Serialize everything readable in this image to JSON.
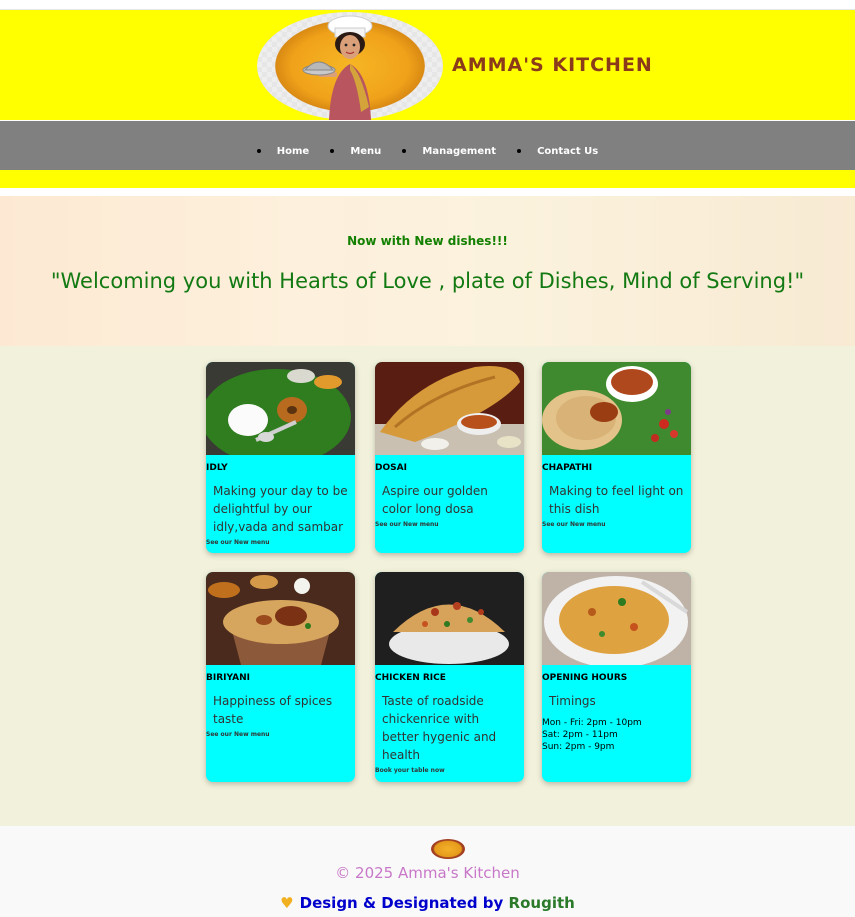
{
  "header": {
    "brand": "AMMA'S KITCHEN",
    "logo_icon": "chef-lady-logo"
  },
  "nav": {
    "items": [
      {
        "label": "Home"
      },
      {
        "label": "Menu"
      },
      {
        "label": "Management"
      },
      {
        "label": "Contact Us"
      }
    ]
  },
  "hero": {
    "announcement": "Now with New dishes!!!",
    "quote": "\"Welcoming you with Hearts of Love , plate of Dishes, Mind of Serving!\""
  },
  "cards": [
    {
      "title": "IDLY",
      "description": "Making your day to be delightful by our idly,vada and sambar",
      "link": "See our New menu",
      "image_icon": "idly-plate-image"
    },
    {
      "title": "DOSAI",
      "description": "Aspire our golden color long dosa",
      "link": "See our New menu",
      "image_icon": "dosa-image"
    },
    {
      "title": "CHAPATHI",
      "description": "Making to feel light on this dish",
      "link": "See our New menu",
      "image_icon": "chapathi-image"
    },
    {
      "title": "BIRIYANI",
      "description": "Happiness of spices taste",
      "link": "See our New menu",
      "image_icon": "biriyani-image"
    },
    {
      "title": "CHICKEN RICE",
      "description": "Taste of roadside chickenrice with better hygenic and health",
      "link": "Book your table now",
      "image_icon": "chicken-rice-image"
    },
    {
      "title": "OPENING HOURS",
      "description": "Timings",
      "hours": [
        "Mon - Fri: 2pm - 10pm",
        "Sat: 2pm - 11pm",
        "Sun: 2pm - 9pm"
      ],
      "image_icon": "kothu-parotta-image"
    }
  ],
  "footer": {
    "copyright": "© 2025 Amma's Kitchen",
    "credit_prefix": "Design & Designated by",
    "credit_name": "Rougith",
    "heart_icon": "yellow-heart-icon"
  },
  "colors": {
    "header_bg": "#ffff00",
    "nav_bg": "#808080",
    "card_bg": "#00ffff",
    "brand_text": "#8b3a1a",
    "hero_text": "#137a13"
  }
}
